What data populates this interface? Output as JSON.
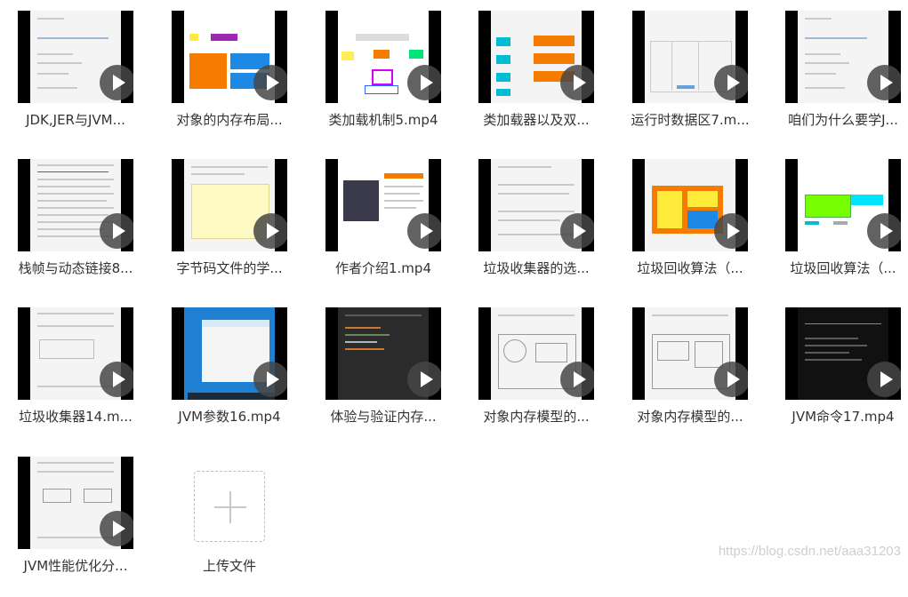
{
  "files": [
    {
      "name": "JDK,JER与JVM..."
    },
    {
      "name": "对象的内存布局..."
    },
    {
      "name": "类加载机制5.mp4"
    },
    {
      "name": "类加载器以及双..."
    },
    {
      "name": "运行时数据区7.m..."
    },
    {
      "name": "咱们为什么要学J..."
    },
    {
      "name": "栈帧与动态链接8..."
    },
    {
      "name": "字节码文件的学..."
    },
    {
      "name": "作者介绍1.mp4"
    },
    {
      "name": "垃圾收集器的选..."
    },
    {
      "name": "垃圾回收算法（..."
    },
    {
      "name": "垃圾回收算法（..."
    },
    {
      "name": "垃圾收集器14.m..."
    },
    {
      "name": "JVM参数16.mp4"
    },
    {
      "name": "体验与验证内存..."
    },
    {
      "name": "对象内存模型的..."
    },
    {
      "name": "对象内存模型的..."
    },
    {
      "name": "JVM命令17.mp4"
    },
    {
      "name": "JVM性能优化分..."
    }
  ],
  "upload": {
    "label": "上传文件"
  },
  "watermark": "https://blog.csdn.net/aaa31203"
}
